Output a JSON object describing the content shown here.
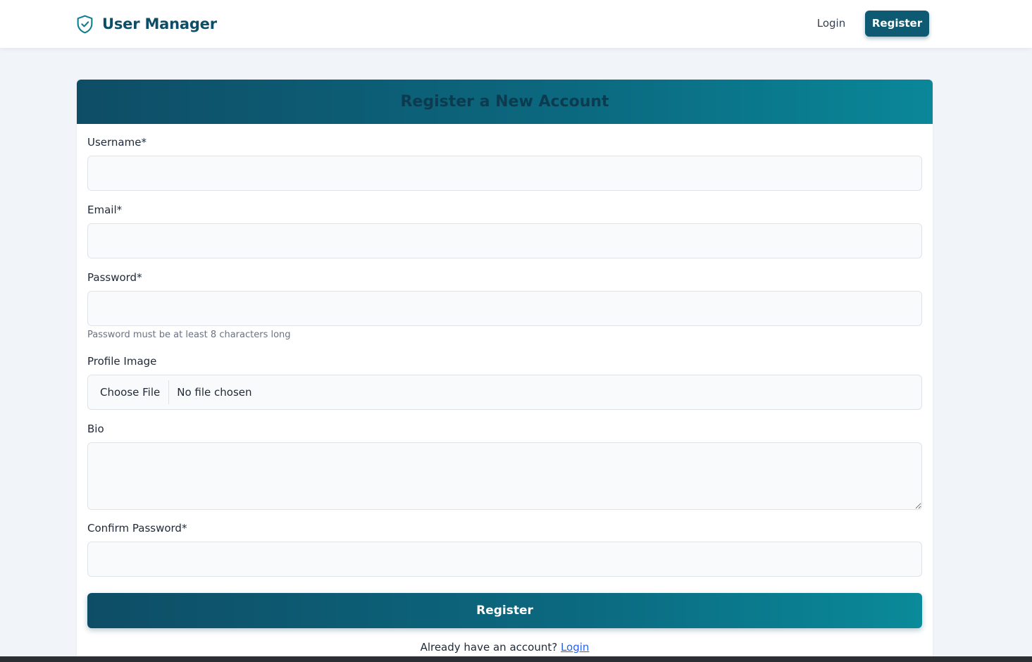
{
  "nav": {
    "brand": "User Manager",
    "brand_icon": "shield-check-icon",
    "login": "Login",
    "register": "Register"
  },
  "colors": {
    "primary": "#0e4d66",
    "accent": "#0a8799",
    "link": "#2563eb",
    "page_bg": "#f1f5f9"
  },
  "form": {
    "title": "Register a New Account",
    "username_label": "Username*",
    "username_value": "",
    "email_label": "Email*",
    "email_value": "",
    "password_label": "Password*",
    "password_value": "",
    "password_hint": "Password must be at least 8 characters long",
    "profile_label": "Profile Image",
    "file_button": "Choose File",
    "file_status": "No file chosen",
    "bio_label": "Bio",
    "bio_value": "",
    "confirm_label": "Confirm Password*",
    "confirm_value": "",
    "submit": "Register",
    "footer_text": "Already have an account?",
    "footer_link": "Login"
  }
}
